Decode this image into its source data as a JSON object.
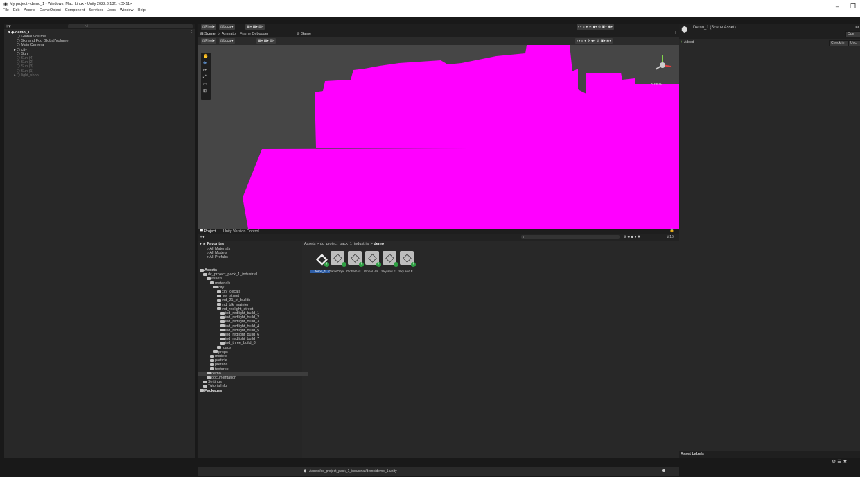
{
  "window": {
    "title": "My project - demo_1 - Windows, Mac, Linux - Unity 2022.3.13f1 <DX11>",
    "menu": [
      "File",
      "Edit",
      "Assets",
      "GameObject",
      "Component",
      "Services",
      "Jobs",
      "Window",
      "Help"
    ]
  },
  "hierarchy": {
    "search_placeholder": "All",
    "root": "demo_1",
    "items": [
      {
        "label": "Global Volume",
        "dim": false,
        "expand": false
      },
      {
        "label": "Sky and Fog Global Volume",
        "dim": false,
        "expand": false
      },
      {
        "label": "Main Camera",
        "dim": false,
        "expand": false
      },
      {
        "label": "city",
        "dim": false,
        "expand": true
      },
      {
        "label": "Sun",
        "dim": false,
        "expand": false
      },
      {
        "label": "Sun (4)",
        "dim": true,
        "expand": false
      },
      {
        "label": "Sun (2)",
        "dim": true,
        "expand": false
      },
      {
        "label": "Sun (3)",
        "dim": true,
        "expand": false
      },
      {
        "label": "Sun (1)",
        "dim": true,
        "expand": false
      },
      {
        "label": "light_shop",
        "dim": true,
        "expand": true
      }
    ]
  },
  "toolbar": {
    "pivot": "Pivot",
    "local": "Local"
  },
  "scene": {
    "tabs": [
      "Scene",
      "Animator",
      "Frame Debugger",
      "Game"
    ],
    "persp_label": "< Persp",
    "colors": {
      "magenta": "#ff00ff",
      "bg": "#464646"
    }
  },
  "project": {
    "tabs": [
      "Project",
      "Unity Version Control"
    ],
    "breadcrumb": [
      "Assets",
      "dc_project_pack_1_industrial",
      "demo"
    ],
    "favorites_label": "Favorites",
    "favorites": [
      "All Materials",
      "All Models",
      "All Prefabs"
    ],
    "tree": [
      {
        "label": "Assets",
        "indent": 0,
        "bold": true
      },
      {
        "label": "dc_project_pack_1_industrial",
        "indent": 1
      },
      {
        "label": "assets",
        "indent": 2
      },
      {
        "label": "materials",
        "indent": 3
      },
      {
        "label": "city",
        "indent": 4
      },
      {
        "label": "city_decals",
        "indent": 5
      },
      {
        "label": "hwl_street",
        "indent": 5
      },
      {
        "label": "ind_21_st_builds",
        "indent": 5
      },
      {
        "label": "ind_blk_mainten",
        "indent": 5
      },
      {
        "label": "ind_redlight_street",
        "indent": 5
      },
      {
        "label": "ind_redlight_build_1",
        "indent": 6
      },
      {
        "label": "ind_redlight_build_2",
        "indent": 6
      },
      {
        "label": "ind_redlight_build_3",
        "indent": 6
      },
      {
        "label": "ind_redlight_build_4",
        "indent": 6
      },
      {
        "label": "ind_redlight_build_5",
        "indent": 6
      },
      {
        "label": "ind_redlight_build_6",
        "indent": 6
      },
      {
        "label": "ind_redlight_build_7",
        "indent": 6
      },
      {
        "label": "ind_three_build_8",
        "indent": 6
      },
      {
        "label": "roads",
        "indent": 5
      },
      {
        "label": "props",
        "indent": 4
      },
      {
        "label": "models",
        "indent": 3
      },
      {
        "label": "particle",
        "indent": 3
      },
      {
        "label": "prefabs",
        "indent": 3
      },
      {
        "label": "textures",
        "indent": 3
      },
      {
        "label": "demo",
        "indent": 2,
        "selected": true
      },
      {
        "label": "documentation",
        "indent": 2
      },
      {
        "label": "Settings",
        "indent": 1
      },
      {
        "label": "TutorialInfo",
        "indent": 1
      },
      {
        "label": "Packages",
        "indent": 0,
        "bold": true
      }
    ],
    "assets": [
      "demo_1",
      "GameObje...",
      "Global Vol...",
      "Global Vol...",
      "Sky and F...",
      "Sky and F..."
    ],
    "count": "16",
    "status_path": "Assets/dc_project_pack_1_industrial/demo/demo_1.unity"
  },
  "inspector": {
    "title": "Demo_1 (Scene Asset)",
    "added": "Added",
    "open_btn": "Ope",
    "checkin_btn": "Check in",
    "undo_btn": "Unc",
    "asset_labels": "Asset Labels"
  }
}
